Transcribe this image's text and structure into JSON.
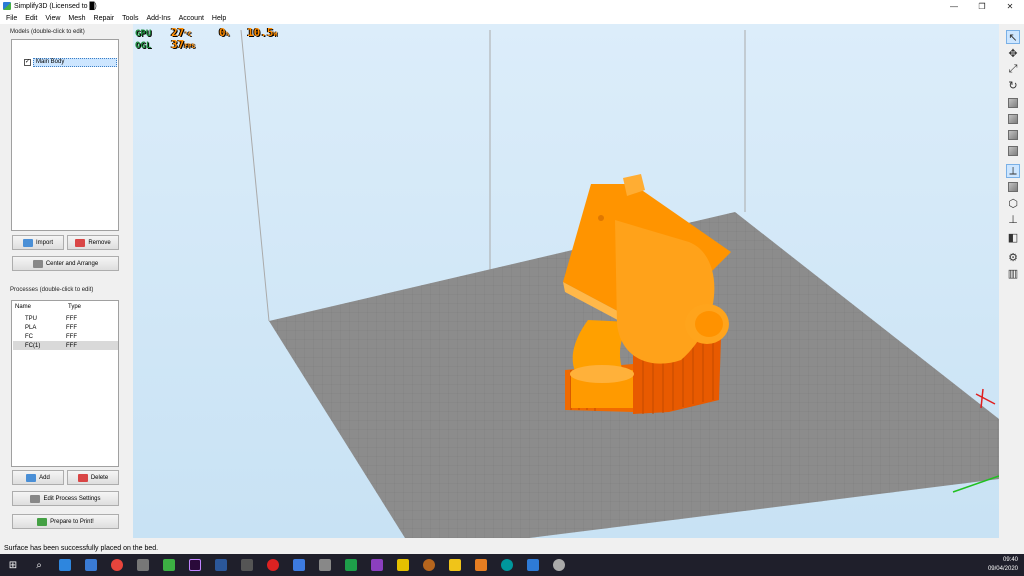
{
  "window": {
    "title": "Simplify3D (Licensed to █)",
    "minimize": "—",
    "restore": "❐",
    "close": "✕"
  },
  "menu": [
    "File",
    "Edit",
    "View",
    "Mesh",
    "Repair",
    "Tools",
    "Add-Ins",
    "Account",
    "Help"
  ],
  "models": {
    "label": "Models (double-click to edit)",
    "items": [
      {
        "name": "Main Body",
        "checked": true
      }
    ],
    "import_label": "Import",
    "remove_label": "Remove",
    "center_label": "Center and Arrange"
  },
  "processes": {
    "label": "Processes (double-click to edit)",
    "columns": [
      "Name",
      "Type"
    ],
    "rows": [
      {
        "name": "TPU",
        "type": "FFF"
      },
      {
        "name": "PLA",
        "type": "FFF"
      },
      {
        "name": "FC",
        "type": "FFF"
      },
      {
        "name": "FC(1)",
        "type": "FFF"
      }
    ],
    "add_label": "Add",
    "delete_label": "Delete",
    "edit_label": "Edit Process Settings",
    "prepare_label": "Prepare to Print!"
  },
  "hud": {
    "gpu_label": "GPU",
    "gpu_temp": "27",
    "gpu_temp_unit": "°C",
    "angle": "0",
    "angle_unit": "%",
    "clock": "10.5",
    "clock_unit": "W",
    "ogl_label": "OGL",
    "fps": "37",
    "fps_unit": "FPS"
  },
  "status": {
    "message": "Surface has been successfully placed on the bed."
  },
  "taskbar": {
    "time": "09:40",
    "date": "09/04/2020"
  },
  "colors": {
    "model": "#ff9a00",
    "bed": "#8c8c8c",
    "sky": "#cde5f6"
  }
}
